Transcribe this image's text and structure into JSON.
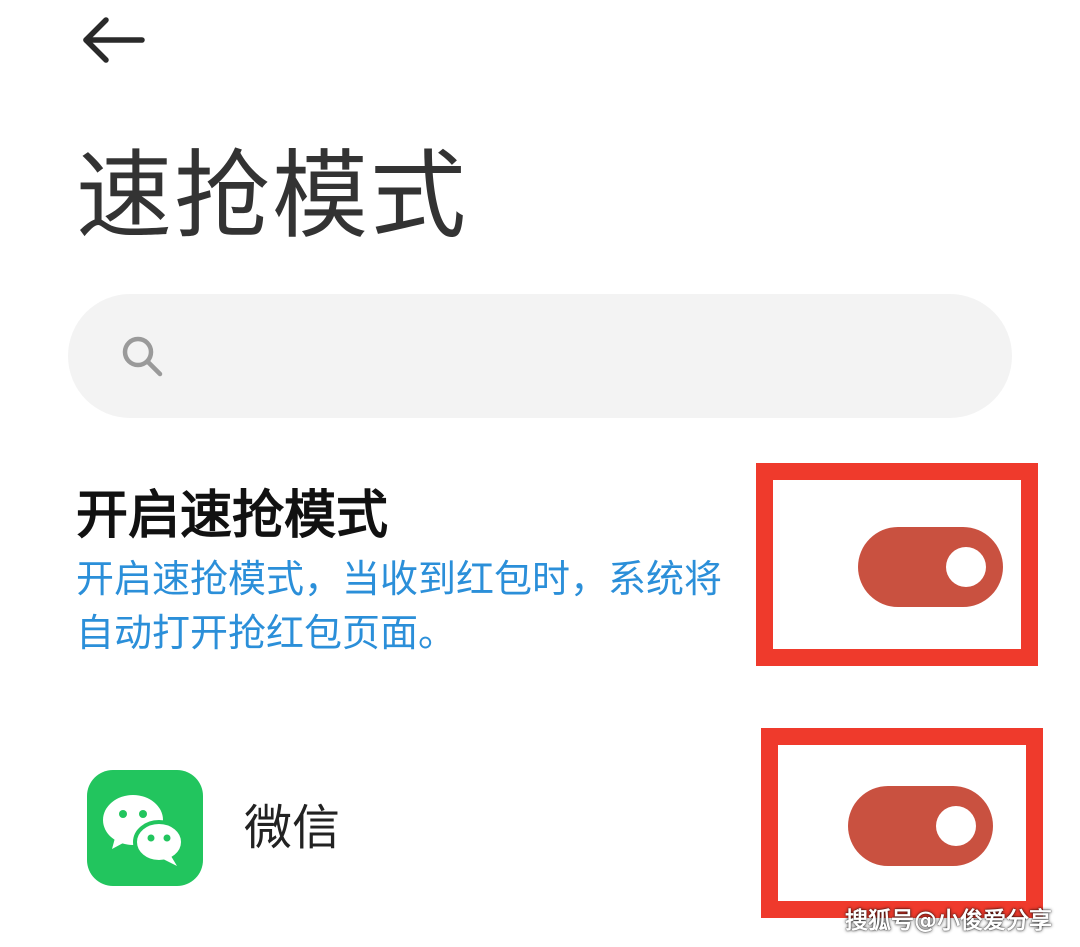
{
  "header": {
    "back_icon": "arrow-left-icon",
    "title": "速抢模式"
  },
  "search": {
    "icon": "search-icon",
    "placeholder": ""
  },
  "speed_mode": {
    "title": "开启速抢模式",
    "description": "开启速抢模式，当收到红包时，系统将自动打开抢红包页面。",
    "enabled": true
  },
  "apps": [
    {
      "name": "微信",
      "icon": "wechat-icon",
      "enabled": true
    }
  ],
  "watermark": "搜狐号@小俊爱分享",
  "colors": {
    "toggle_on": "#c95140",
    "highlight_frame": "#ef3a2c",
    "description_text": "#2b8fd9",
    "wechat_green": "#22c55e",
    "search_bg": "#f3f3f3"
  }
}
